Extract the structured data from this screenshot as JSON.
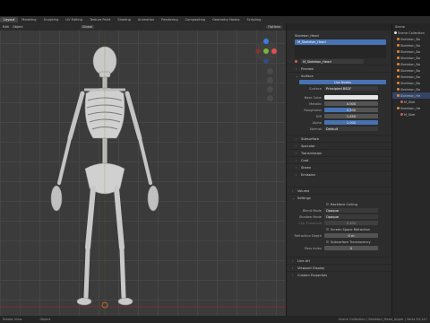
{
  "topbar": {
    "tabs": [
      "Layout",
      "Modeling",
      "Sculpting",
      "UV Editing",
      "Texture Paint",
      "Shading",
      "Animation",
      "Rendering",
      "Compositing",
      "Geometry Nodes",
      "Scripting"
    ],
    "active_tab": "Layout"
  },
  "viewport": {
    "header_items": [
      "Edit",
      "Object",
      "Global",
      "Options"
    ],
    "gizmo_labels": {
      "x": "X",
      "y": "Y",
      "z": "Z"
    }
  },
  "properties": {
    "object_name": "Skeleton_Head",
    "material_slot": "M_Skeleton_Head",
    "material_name": "M_Skeleton_Head",
    "sections": {
      "preview": "Preview",
      "surface": "Surface",
      "subsurface": "Subsurface",
      "specular": "Specular",
      "transmission": "Transmission",
      "coat": "Coat",
      "sheen": "Sheen",
      "emission": "Emission",
      "volume": "Volume",
      "settings": "Settings",
      "line_art": "Line Art",
      "viewport_display": "Viewport Display",
      "custom_properties": "Custom Properties"
    },
    "use_nodes_label": "Use Nodes",
    "surface_row": {
      "label": "Surface",
      "value": "Principled BSDF"
    },
    "params": [
      {
        "label": "Base Color",
        "value": ""
      },
      {
        "label": "Metallic",
        "value": "0.000"
      },
      {
        "label": "Roughness",
        "value": "0.500"
      },
      {
        "label": "IOR",
        "value": "1.450"
      },
      {
        "label": "Alpha",
        "value": "1.000"
      },
      {
        "label": "Normal",
        "value": "Default"
      }
    ],
    "settings": {
      "backface_culling": "Backface Culling",
      "blend_mode": {
        "label": "Blend Mode",
        "value": "Opaque"
      },
      "shadow_mode": {
        "label": "Shadow Mode",
        "value": "Opaque"
      },
      "clip_threshold": {
        "label": "Clip Threshold",
        "value": "0.500"
      },
      "screen_space_refraction": "Screen Space Refraction",
      "refraction_depth": {
        "label": "Refraction Depth",
        "value": "0 m"
      },
      "subsurface_translucency": "Subsurface Translucency",
      "pass_index": {
        "label": "Pass Index",
        "value": "0"
      }
    }
  },
  "outliner": {
    "title": "Scene",
    "items": [
      "Scene Collection",
      "Skeleton_Bo",
      "Skeleton_Bo",
      "Skeleton_Bo",
      "Skeleton_Bo",
      "Skeleton_Bo",
      "Skeleton_Bo",
      "Skeleton_Bo",
      "Skeleton_Bo",
      "Skeleton_Bo",
      "Skeleton_He",
      "M_Skel",
      "Skeleton_He",
      "M_Skel"
    ]
  },
  "statusbar": {
    "left": "Rotate View",
    "middle": "Object",
    "right": "Scene Collection | Skeleton_Head_Upper | Verts 93,147"
  },
  "colors": {
    "accent": "#4772b3",
    "axis_x": "#e05050",
    "axis_y": "#7bb33a",
    "axis_z": "#3a7ee0"
  }
}
